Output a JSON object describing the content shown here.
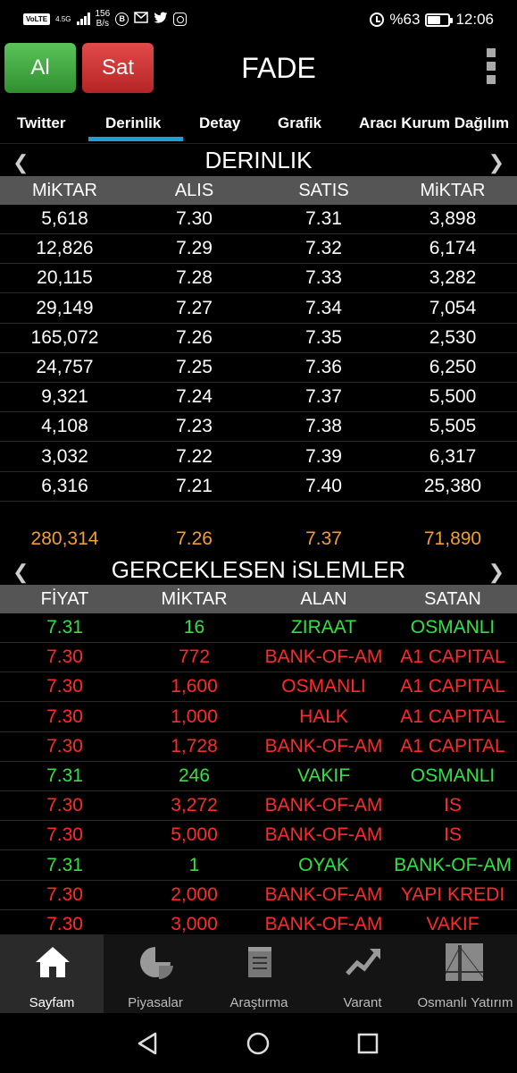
{
  "status_bar": {
    "network_tag": "VoLTE",
    "network_type": "4.5G",
    "speed_value": "156",
    "speed_unit": "B/s",
    "battery": "%63",
    "time": "12:06",
    "icons": [
      "circle-b-icon",
      "gmail-icon",
      "twitter-icon",
      "instagram-icon",
      "alarm-icon",
      "battery-icon"
    ]
  },
  "header": {
    "buy_label": "Al",
    "sell_label": "Sat",
    "symbol": "FADE",
    "menu_icon": "kebab-menu-icon",
    "buy_color": "#3ea83c",
    "sell_color": "#cf3434"
  },
  "tabs": [
    "Twitter",
    "Derinlik",
    "Detay",
    "Grafik",
    "Aracı Kurum Dağılım"
  ],
  "active_tab": "Derinlik",
  "depth": {
    "title": "DERINLIK",
    "columns": [
      "MiKTAR",
      "ALIS",
      "SATIS",
      "MiKTAR"
    ],
    "rows": [
      [
        "5,618",
        "7.30",
        "7.31",
        "3,898"
      ],
      [
        "12,826",
        "7.29",
        "7.32",
        "6,174"
      ],
      [
        "20,115",
        "7.28",
        "7.33",
        "3,282"
      ],
      [
        "29,149",
        "7.27",
        "7.34",
        "7,054"
      ],
      [
        "165,072",
        "7.26",
        "7.35",
        "2,530"
      ],
      [
        "24,757",
        "7.25",
        "7.36",
        "6,250"
      ],
      [
        "9,321",
        "7.24",
        "7.37",
        "5,500"
      ],
      [
        "4,108",
        "7.23",
        "7.38",
        "5,505"
      ],
      [
        "3,032",
        "7.22",
        "7.39",
        "6,317"
      ],
      [
        "6,316",
        "7.21",
        "7.40",
        "25,380"
      ]
    ],
    "totals": [
      "280,314",
      "7.26",
      "7.37",
      "71,890"
    ]
  },
  "trades": {
    "title": "GERCEKLESEN iSLEMLER",
    "columns": [
      "FİYAT",
      "MİKTAR",
      "ALAN",
      "SATAN"
    ],
    "rows": [
      {
        "price": "7.31",
        "qty": "16",
        "buyer": "ZIRAAT",
        "seller": "OSMANLI",
        "dir": "up"
      },
      {
        "price": "7.30",
        "qty": "772",
        "buyer": "BANK-OF-AM",
        "seller": "A1 CAPITAL",
        "dir": "down"
      },
      {
        "price": "7.30",
        "qty": "1,600",
        "buyer": "OSMANLI",
        "seller": "A1 CAPITAL",
        "dir": "down"
      },
      {
        "price": "7.30",
        "qty": "1,000",
        "buyer": "HALK",
        "seller": "A1 CAPITAL",
        "dir": "down"
      },
      {
        "price": "7.30",
        "qty": "1,728",
        "buyer": "BANK-OF-AM",
        "seller": "A1 CAPITAL",
        "dir": "down"
      },
      {
        "price": "7.31",
        "qty": "246",
        "buyer": "VAKIF",
        "seller": "OSMANLI",
        "dir": "up"
      },
      {
        "price": "7.30",
        "qty": "3,272",
        "buyer": "BANK-OF-AM",
        "seller": "IS",
        "dir": "down"
      },
      {
        "price": "7.30",
        "qty": "5,000",
        "buyer": "BANK-OF-AM",
        "seller": "IS",
        "dir": "down"
      },
      {
        "price": "7.31",
        "qty": "1",
        "buyer": "OYAK",
        "seller": "BANK-OF-AM",
        "dir": "up"
      },
      {
        "price": "7.30",
        "qty": "2,000",
        "buyer": "BANK-OF-AM",
        "seller": "YAPI KREDI",
        "dir": "down"
      },
      {
        "price": "7.30",
        "qty": "3,000",
        "buyer": "BANK-OF-AM",
        "seller": "VAKIF",
        "dir": "down"
      }
    ],
    "up_color": "#35e044",
    "down_color": "#ff2a2a"
  },
  "bottom_nav": [
    {
      "label": "Sayfam",
      "icon": "home-icon",
      "active": true
    },
    {
      "label": "Piyasalar",
      "icon": "pie-chart-icon",
      "active": false
    },
    {
      "label": "Araştırma",
      "icon": "notepad-icon",
      "active": false
    },
    {
      "label": "Varant",
      "icon": "trend-up-icon",
      "active": false
    },
    {
      "label": "Osmanlı Yatırım",
      "icon": "bridge-logo-icon",
      "active": false
    }
  ],
  "system_nav": [
    "back-icon",
    "home-circle-icon",
    "recents-icon"
  ],
  "totals_color": "#f0a030"
}
